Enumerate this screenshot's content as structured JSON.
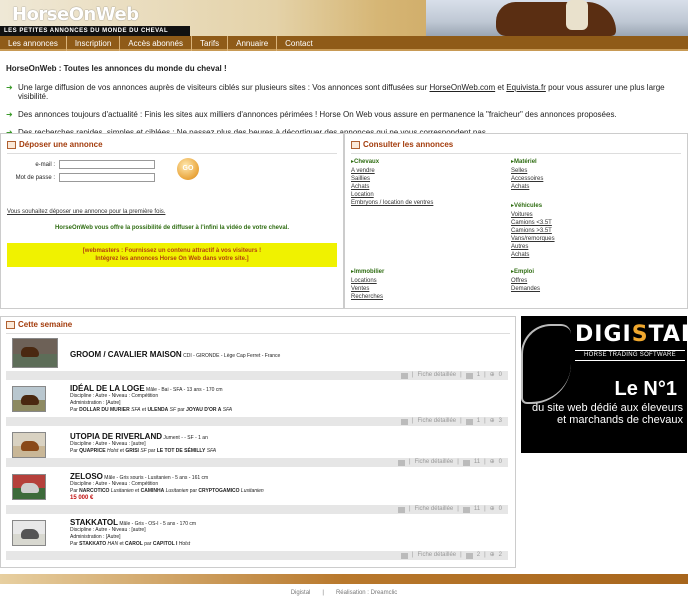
{
  "header": {
    "logo": "HorseOnWeb",
    "tagline": "LES PETITES ANNONCES DU MONDE DU CHEVAL"
  },
  "nav": [
    "Les annonces",
    "Inscription",
    "Accès abonnés",
    "Tarifs",
    "Annuaire",
    "Contact"
  ],
  "intro": {
    "title": "HorseOnWeb : Toutes les annonces du monde du cheval !",
    "b1_pre": "Une large diffusion de vos annonces auprès de visiteurs ciblés sur plusieurs sites : Vos annonces sont diffusées sur ",
    "b1_link1": "HorseOnWeb.com",
    "b1_mid": " et ",
    "b1_link2": "Equivista.fr",
    "b1_post": " pour vous assurer une plus large visibilité.",
    "b2": "Des annonces toujours d'actualité : Finis les sites aux milliers d'annonces périmées ! Horse On Web vous assure en permanence la \"fraicheur\" des annonces proposées.",
    "b3": "Des recherches rapides, simples et ciblées : Ne passez plus des heures à décortiquer des annonces qui ne vous correspondent pas."
  },
  "deposer": {
    "title": "Déposer une annonce",
    "email_label": "e-mail :",
    "password_label": "Mot de passe :",
    "go_label": "GO",
    "link": "Vous souhaitez déposer une annonce pour la première fois.",
    "video_text": "HorseOnWeb vous offre la possibilité de diffuser à l'infini la vidéo de votre cheval.",
    "webmasters_line1": "[webmasters : Fournissez un contenu attractif à vos visiteurs !",
    "webmasters_line2": "Intégrez les annonces Horse On Web dans votre site.]"
  },
  "consulter": {
    "title": "Consulter les annonces",
    "chevaux": {
      "title": "Chevaux",
      "links": [
        "A vendre",
        "Saillies",
        "Achats",
        "Location",
        "Embryons / location de ventres"
      ]
    },
    "materiel": {
      "title": "Matériel",
      "links": [
        "Selles",
        "Accessoires",
        "Achats"
      ]
    },
    "vehicules": {
      "title": "Véhicules",
      "links": [
        "Voitures",
        "Camions <3.5T",
        "Camions >3.5T",
        "Vans/remorques",
        "Autres",
        "Achats"
      ]
    },
    "immobilier": {
      "title": "Immobilier",
      "links": [
        "Locations",
        "Ventes",
        "Recherches"
      ]
    },
    "emploi": {
      "title": "Emploi",
      "links": [
        "Offres",
        "Demandes"
      ]
    }
  },
  "semaine": {
    "title": "Cette semaine",
    "featured_name": "GROOM / CAVALIER MAISON",
    "featured_meta": " CDI - GIRONDE - Lège Cap Ferret - France",
    "fiche": "Fiche détaillée",
    "items": [
      {
        "name": "IDÉAL DE LA LOGE",
        "sub": " Mâle - Bai - SFA - 13 ans - 170 cm",
        "l1": "Discipline : Autre - Niveau : Compétition",
        "l2": "Administration : [Autre]",
        "par": "Par ",
        "p1": "DOLLAR DU MURIER",
        "p1b": " SFA",
        "et": " et ",
        "p2": "ULENDA",
        "p2b": " SF",
        "par2": " par ",
        "p3": "JOYAU D'OR A",
        "p3b": " SFA",
        "price": "",
        "c1": "1",
        "c2": "3"
      },
      {
        "name": "UTOPIA DE RIVERLAND",
        "sub": " Jument - - SF - 1 an",
        "l1": "Discipline : Autre - Niveau : [autre]",
        "l2": "",
        "par": "Par ",
        "p1": "QUAPRICE",
        "p1b": " Holst",
        "et": " et ",
        "p2": "GRISI",
        "p2b": " SF",
        "par2": " par ",
        "p3": "LE TOT DE SÉMILLY",
        "p3b": " SFA",
        "price": "",
        "c1": "11",
        "c2": "0"
      },
      {
        "name": "ZELOSO",
        "sub": " Mâle - Gris souris - Lusitanien - 5 ans - 161 cm",
        "l1": "Discipline : Autre - Niveau : Compétition",
        "l2": "",
        "par": "Par ",
        "p1": "NARCOTICO",
        "p1b": " Lusitanien",
        "et": " et ",
        "p2": "CAMINHA",
        "p2b": " Lusitanien",
        "par2": " par ",
        "p3": "CRYPTOGAMICO",
        "p3b": " Lusitanien",
        "price": "15 000 €",
        "c1": "1",
        "c2": "0"
      },
      {
        "name": "STAKKATOL",
        "sub": " Mâle - Gris - OS-I - 5 ans - 170 cm",
        "l1": "Discipline : Autre - Niveau : [autre]",
        "l2": "Administration : [Autre]",
        "par": "Par ",
        "p1": "STAKKATO",
        "p1b": " HAN",
        "et": " et ",
        "p2": "CAROL",
        "p2b": "",
        "par2": " par ",
        "p3": "CAPITOL I",
        "p3b": " Holst",
        "price": "",
        "c1": "11",
        "c2": "0"
      }
    ],
    "bar_counts": [
      {
        "c1": "1",
        "c2": "0"
      },
      {
        "c1": "1",
        "c2": "3"
      },
      {
        "c1": "11",
        "c2": "0"
      },
      {
        "c1": "11",
        "c2": "0"
      },
      {
        "c1": "2",
        "c2": "2"
      }
    ]
  },
  "ad": {
    "logo_pre": "DIGI",
    "logo_s": "S",
    "logo_post": "TAL",
    "sub": "HORSE TRADING SOFTWARE",
    "big": "Le N°1",
    "text": "du site web dédié aux éleveurs et marchands de chevaux"
  },
  "footer": {
    "left": "Digistal",
    "sep": "|",
    "right": "Réalisation : Dreamclic"
  }
}
